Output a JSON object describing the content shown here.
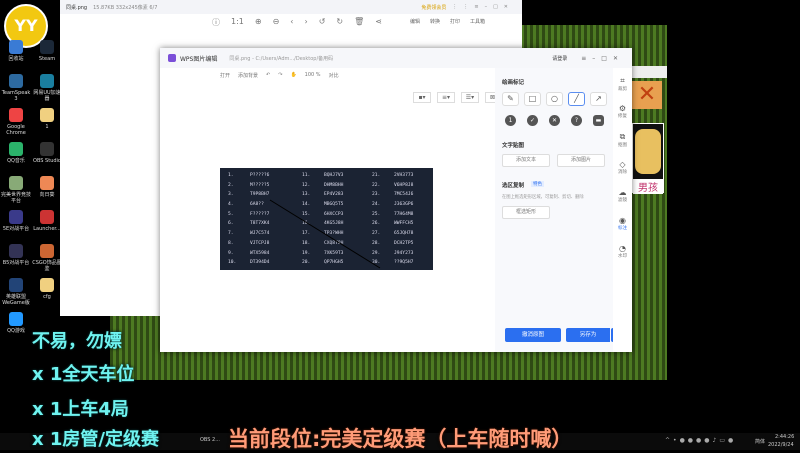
{
  "desktop": {
    "icons": [
      "回收站",
      "Steam",
      "TeamSpeak 3",
      "网易UU加速器",
      "Google Chrome",
      "1",
      "QQ音乐",
      "OBS Studio",
      "完美世界竞技平台",
      "向日葵",
      "5E对战平台",
      "Launcher...",
      "B5对战平台",
      "CSGO饰品图鉴",
      "英雄联盟WeGame版",
      "cfg",
      "QQ游戏"
    ]
  },
  "logo": {
    "text": "YY",
    "color": "#f2c811"
  },
  "viewer": {
    "title": "同桌.png",
    "meta": "15.87KB  332x245像素  6/7",
    "vip": "免费领会员",
    "actions": [
      "编辑",
      "转换",
      "打印",
      "工具箱"
    ]
  },
  "wps": {
    "app_title": "WPS图片编辑",
    "file_path": "同桌.png - C:/Users/Adm.../Desktop/备用码",
    "login": "请登录",
    "toolbar": {
      "open": "打开",
      "add_bg": "添加背景",
      "zoom": "100 %",
      "compare": "对比"
    },
    "panel": {
      "draw_title": "绘画标记",
      "text_title": "文字贴图",
      "add_text": "添加文本",
      "add_image": "添加图片",
      "select_title": "选区复制",
      "select_badge": "特色",
      "select_desc": "在图上框选矩形区域，可复制、剪切、删除",
      "select_rect": "框选矩形",
      "reset": "撤消原图",
      "save_as": "另存为"
    },
    "side": [
      "裁剪",
      "修复",
      "抠图",
      "消除",
      "滤镜",
      "标注",
      "水印"
    ]
  },
  "codes": {
    "col1": [
      "P?????6",
      "M?????5",
      "T9P8BH7",
      "6A8??",
      "F?????7",
      "T8T7XK4",
      "WJ7C574",
      "VJTCPJ8",
      "WTX5984",
      "DT394D4"
    ],
    "col2": [
      "BQHJ7V3",
      "DHM8BHH",
      "EP4V283",
      "MBGQ5T5",
      "6HXCCP3",
      "4KG5J8H",
      "TP3?WHH",
      "CXQ8T8H",
      "7XK59T3",
      "QP7HGH5"
    ],
    "col3": [
      "2VH3773",
      "V6HP8J8",
      "7MC54J6",
      "J363GP6",
      "77H64M8",
      "WWFFCH5",
      "65JQH78",
      "DCH2TP5",
      "J94Y273",
      "??9Q5H7"
    ]
  },
  "overlay": {
    "lines": [
      "不易，勿嫖",
      "x 1全天车位",
      "x 1上车4局",
      "x 1房管/定级赛"
    ],
    "rank": "当前段位:完美定级赛（上车随时喊）",
    "game_label": "男孩"
  },
  "taskbar": {
    "obs": "OBS 2...",
    "ime": "简体",
    "time": "2:44:26",
    "date": "2022/9/24"
  }
}
